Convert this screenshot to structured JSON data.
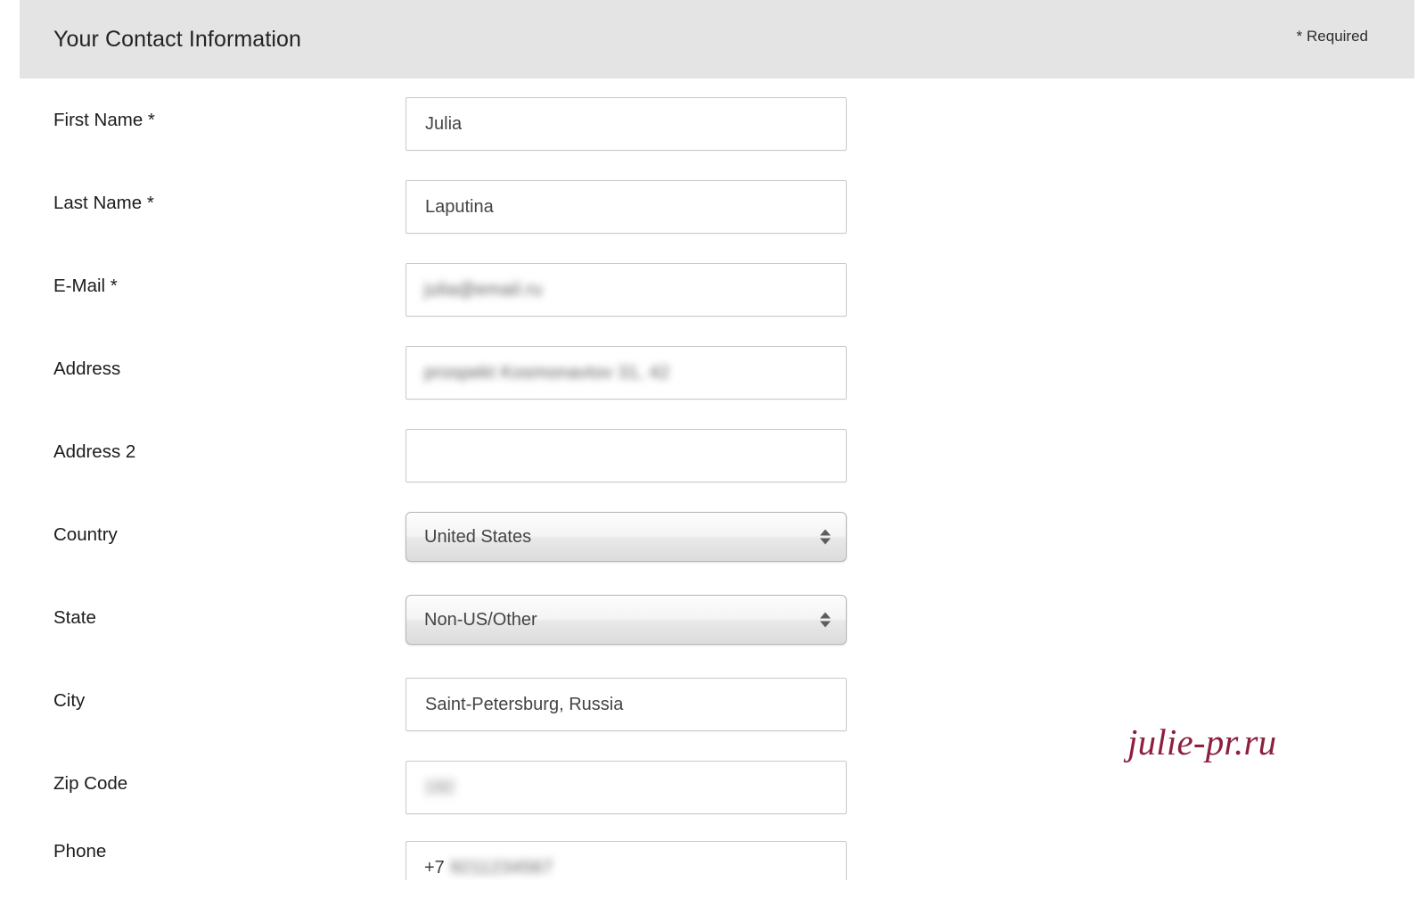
{
  "header": {
    "title": "Your Contact Information",
    "required_note": "* Required"
  },
  "form": {
    "fields": [
      {
        "label": "First Name *",
        "type": "text",
        "value": "Julia",
        "redacted": false
      },
      {
        "label": "Last Name *",
        "type": "text",
        "value": "Laputina",
        "redacted": false
      },
      {
        "label": "E-Mail *",
        "type": "text",
        "value": "julia@email.ru",
        "redacted": true
      },
      {
        "label": "Address",
        "type": "text",
        "value": "prospekt Kosmonavtov 31, 42",
        "redacted": true
      },
      {
        "label": "Address 2",
        "type": "text",
        "value": "",
        "redacted": false
      },
      {
        "label": "Country",
        "type": "select",
        "value": "United States"
      },
      {
        "label": "State",
        "type": "select",
        "value": "Non-US/Other"
      },
      {
        "label": "City",
        "type": "text",
        "value": "Saint-Petersburg, Russia",
        "redacted": false
      },
      {
        "label": "Zip Code",
        "type": "text",
        "value": "192",
        "redacted": true
      },
      {
        "label": "Phone",
        "type": "text",
        "value_prefix": "+7",
        "value": "9211234567",
        "redacted": true
      }
    ]
  },
  "watermark": {
    "text": "julie-pr.ru",
    "color": "#8d1f3f"
  },
  "icons": {
    "select_stepper": "updown-arrows-icon"
  }
}
